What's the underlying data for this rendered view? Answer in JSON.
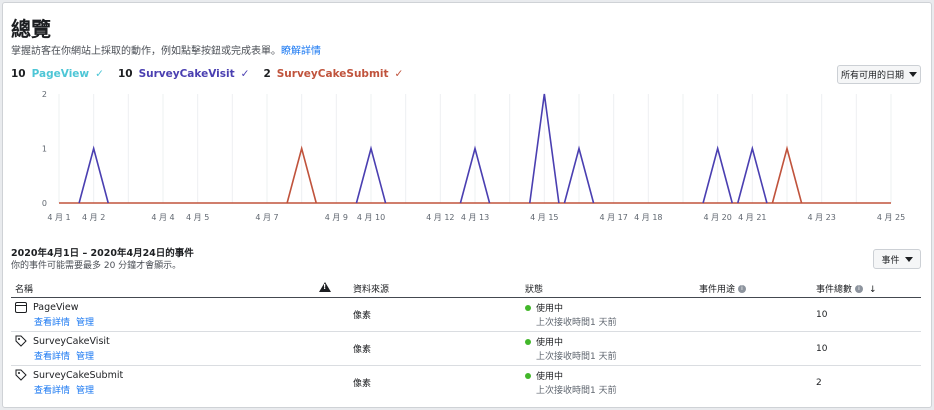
{
  "header": {
    "title": "總覽",
    "subtitle": "掌握訪客在你網站上採取的動作，例如點擊按鈕或完成表單。",
    "learn_more": "瞭解詳情"
  },
  "legend": [
    {
      "count": "10",
      "name": "PageView",
      "check": "✓",
      "color": "#4dc6d6"
    },
    {
      "count": "10",
      "name": "SurveyCakeVisit",
      "check": "✓",
      "color": "#4a3fb1"
    },
    {
      "count": "2",
      "name": "SurveyCakeSubmit",
      "check": "✓",
      "color": "#c0533c"
    }
  ],
  "date_filter": {
    "label": "所有可用的日期"
  },
  "chart_data": {
    "type": "line",
    "x": [
      "4月1",
      "4月2",
      "4月3",
      "4月4",
      "4月5",
      "4月6",
      "4月7",
      "4月8",
      "4月9",
      "4月10",
      "4月11",
      "4月12",
      "4月13",
      "4月14",
      "4月15",
      "4月16",
      "4月17",
      "4月18",
      "4月19",
      "4月20",
      "4月21",
      "4月22",
      "4月23",
      "4月24",
      "4月25"
    ],
    "tick_labels": [
      "4 月 1",
      "4 月 2",
      "4 月 4",
      "4 月 5",
      "4 月 7",
      "4 月 9",
      "4 月 10",
      "4 月 12",
      "4 月 13",
      "4 月 15",
      "4 月 17",
      "4 月 18",
      "4 月 20",
      "4 月 21",
      "4 月 23",
      "4 月 25"
    ],
    "tick_dates": [
      "4月1",
      "4月2",
      "4月4",
      "4月5",
      "4月7",
      "4月9",
      "4月10",
      "4月12",
      "4月13",
      "4月15",
      "4月17",
      "4月18",
      "4月20",
      "4月21",
      "4月23",
      "4月25"
    ],
    "yticks": [
      0,
      1,
      2
    ],
    "ylim": [
      0,
      2
    ],
    "series": [
      {
        "name": "SurveyCakeVisit",
        "color": "#4a3fb1",
        "peaks": [
          {
            "x": "4月2",
            "y": 1
          },
          {
            "x": "4月10",
            "y": 1
          },
          {
            "x": "4月13",
            "y": 1
          },
          {
            "x": "4月15",
            "y": 2
          },
          {
            "x": "4月16",
            "y": 1
          },
          {
            "x": "4月20",
            "y": 1
          },
          {
            "x": "4月21",
            "y": 1
          }
        ]
      },
      {
        "name": "SurveyCakeSubmit",
        "color": "#c0533c",
        "peaks": [
          {
            "x": "4月8",
            "y": 1
          },
          {
            "x": "4月22",
            "y": 1
          }
        ]
      }
    ]
  },
  "events_section": {
    "range_title": "2020年4月1日 – 2020年4月24日的事件",
    "note": "你的事件可能需要最多 20 分鐘才會顯示。",
    "events_button": "事件"
  },
  "table": {
    "headers": {
      "name": "名稱",
      "source": "資料來源",
      "status": "狀態",
      "usage": "事件用途",
      "total": "事件總數"
    },
    "rows": [
      {
        "name": "PageView",
        "icon": "page-icon",
        "link_details": "查看詳情",
        "link_manage": "管理",
        "source": "像素",
        "status": "使用中",
        "last": "上次接收時間1 天前",
        "total": "10"
      },
      {
        "name": "SurveyCakeVisit",
        "icon": "tag-icon",
        "link_details": "查看詳情",
        "link_manage": "管理",
        "source": "像素",
        "status": "使用中",
        "last": "上次接收時間1 天前",
        "total": "10"
      },
      {
        "name": "SurveyCakeSubmit",
        "icon": "tag-icon",
        "link_details": "查看詳情",
        "link_manage": "管理",
        "source": "像素",
        "status": "使用中",
        "last": "上次接收時間1 天前",
        "total": "2"
      }
    ]
  }
}
